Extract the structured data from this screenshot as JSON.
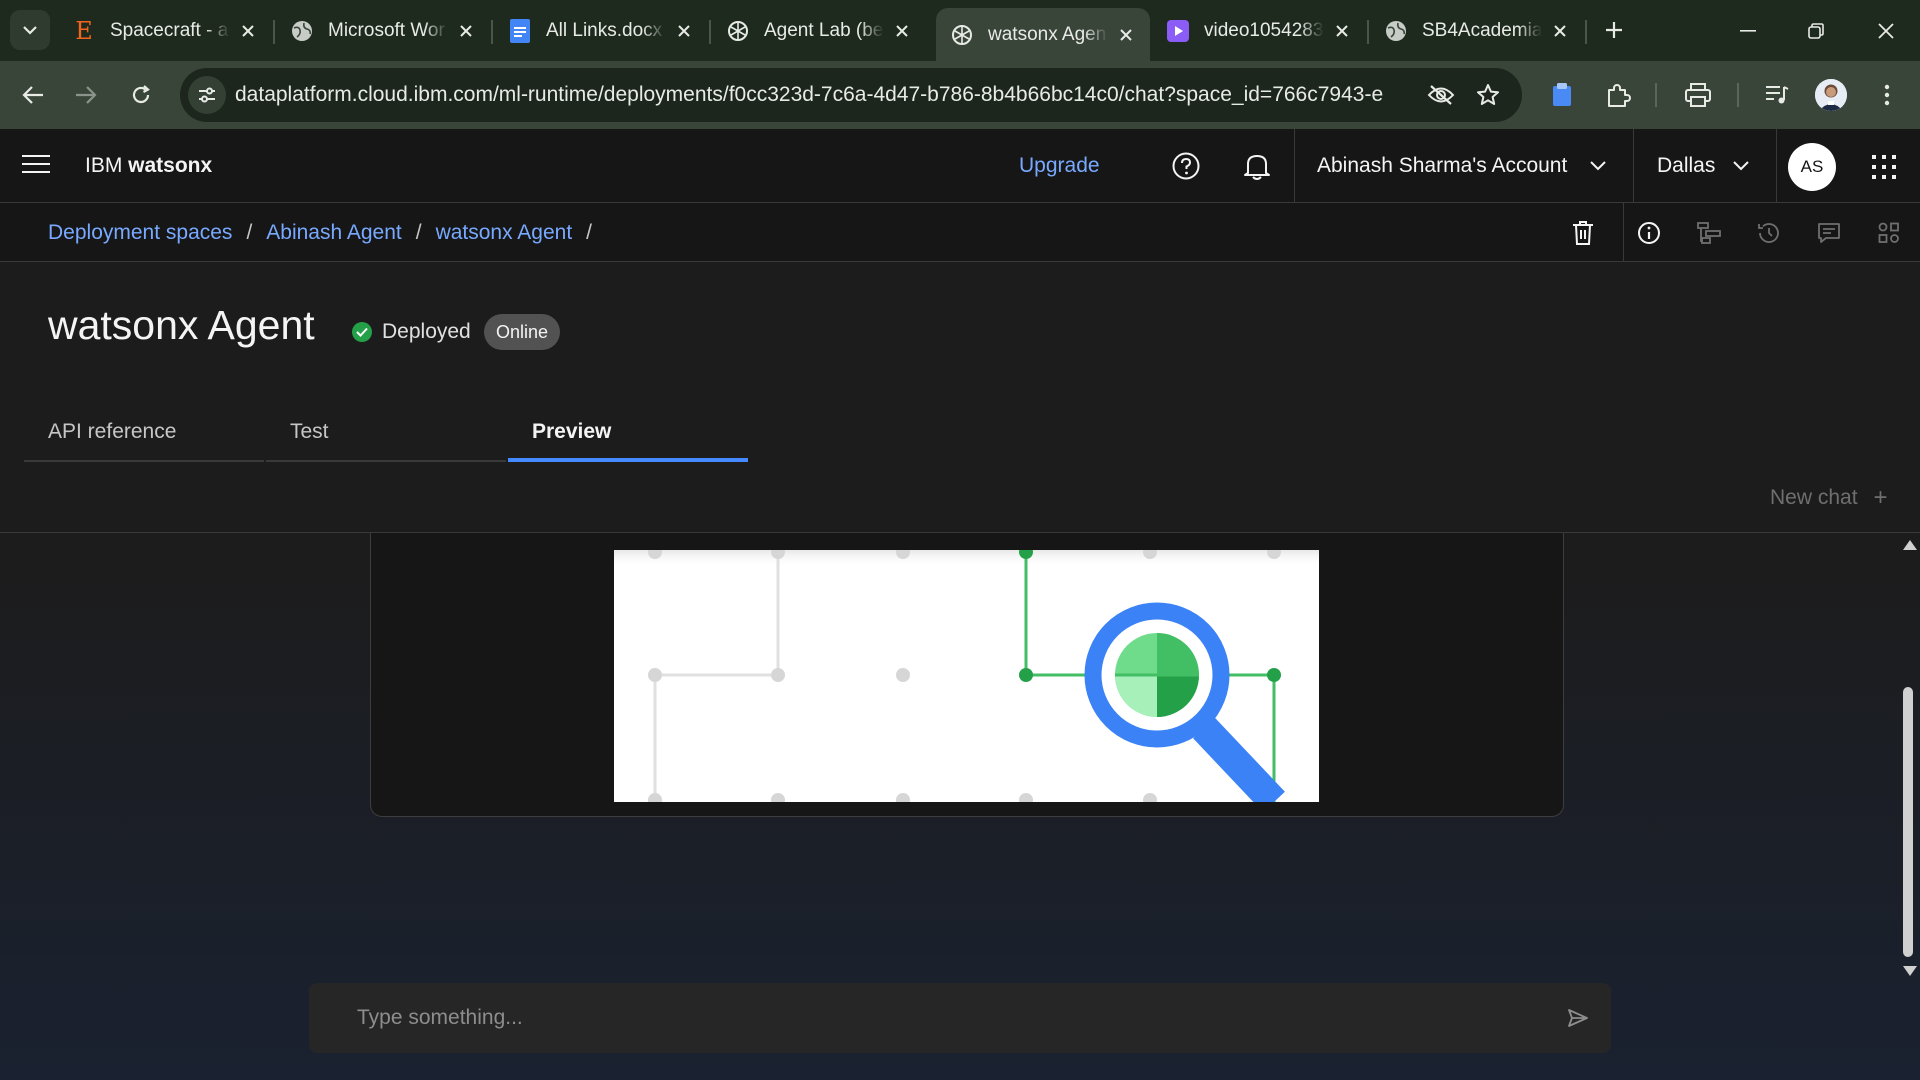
{
  "browser": {
    "tabs": [
      {
        "title": "Spacecraft - ai",
        "favicon": "letter-e-icon",
        "active": false
      },
      {
        "title": "Microsoft Wor",
        "favicon": "globe-icon",
        "active": false
      },
      {
        "title": "All Links.docx",
        "favicon": "docs-icon",
        "active": false
      },
      {
        "title": "Agent Lab (be",
        "favicon": "openai-icon",
        "active": false
      },
      {
        "title": "watsonx Agen",
        "favicon": "openai-icon",
        "active": true
      },
      {
        "title": "video1054283",
        "favicon": "video-icon",
        "active": false
      },
      {
        "title": "SB4Academia",
        "favicon": "globe-icon",
        "active": false
      }
    ],
    "url": "dataplatform.cloud.ibm.com/ml-runtime/deployments/f0cc323d-7c6a-4d47-b786-8b4b66bc14c0/chat?space_id=766c7943-e..."
  },
  "header": {
    "brand_prefix": "IBM ",
    "brand_name": "watsonx",
    "upgrade_label": "Upgrade",
    "account_label": "Abinash Sharma's Account",
    "region_label": "Dallas",
    "avatar_initials": "AS"
  },
  "breadcrumb": {
    "items": [
      "Deployment spaces",
      "Abinash Agent",
      "watsonx Agent"
    ],
    "separator": "/"
  },
  "page": {
    "title": "watsonx Agent",
    "status": "Deployed",
    "tag": "Online",
    "tabs": [
      {
        "label": "API reference",
        "active": false
      },
      {
        "label": "Test",
        "active": false
      },
      {
        "label": "Preview",
        "active": true
      }
    ],
    "new_chat_label": "New chat",
    "new_chat_icon": "+"
  },
  "chat": {
    "input_placeholder": "Type something..."
  },
  "colors": {
    "accent": "#4589ff",
    "link": "#78a9ff",
    "status_ok": "#24a148",
    "illustration_green": "#42be65",
    "illustration_blue": "#3b82f6"
  }
}
